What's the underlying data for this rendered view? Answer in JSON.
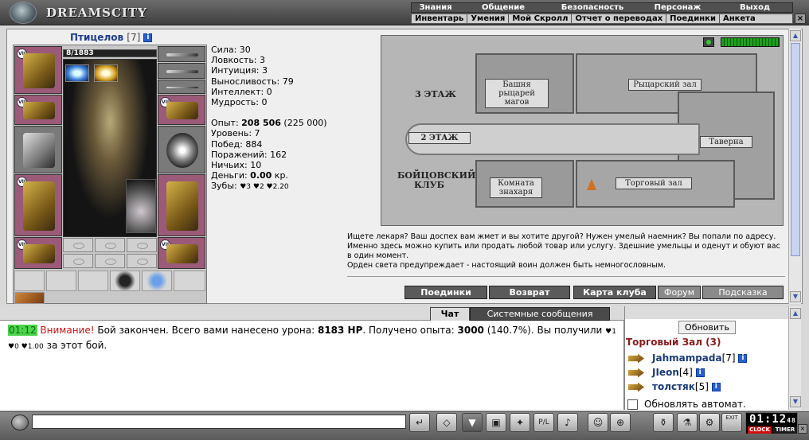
{
  "app": {
    "logo_text": "DREAMSCITY"
  },
  "menu_top": [
    "Знания",
    "Общение",
    "Безопасность",
    "Персонаж",
    "Выход"
  ],
  "menu_sub": [
    "Инвентарь",
    "Умения",
    "Мой Скролл",
    "Отчет о переводах",
    "Поединки",
    "Анкета"
  ],
  "window": {
    "close_glyph": "×",
    "minimize_glyph": "×"
  },
  "character": {
    "name": "Птицелов",
    "level": "[7]",
    "info_glyph": "i",
    "hp": "8/1883",
    "slot_badge": "VII"
  },
  "stats": {
    "strength": "Сила: 30",
    "agility": "Ловкость: 3",
    "intuition": "Интуиция: 3",
    "endurance": "Выносливость: 79",
    "intellect": "Интеллект: 0",
    "wisdom": "Мудрость: 0",
    "exp_label": "Опыт: ",
    "exp_value": "208 506",
    "exp_next": " (225 000)",
    "level": "Уровень: 7",
    "wins": "Побед: 884",
    "losses": "Поражений: 162",
    "draws": "Ничьих: 10",
    "money_label": "Деньги: ",
    "money_value": "0.00",
    "money_unit": " кр.",
    "teeth_label": "Зубы: ",
    "teeth_values": "♥3 ♥2 ♥2.20"
  },
  "map": {
    "floor3": "3 ЭТАЖ",
    "floor2": "2 ЭТАЖ",
    "club": "БОЙЦОВСКИЙ КЛУБ",
    "rooms": {
      "knights_tower": "Башня рыцарей магов",
      "knights_hall": "Рыцарский зал",
      "tavern": "Таверна",
      "healer": "Комната знахаря",
      "trade_hall": "Торговый зал"
    }
  },
  "description": {
    "text": "Ищете лекаря? Ваш доспех вам жмет и вы хотите другой? Нужен умелый наемник? Вы попали по адресу. Именно здесь можно купить или продать любой товар или услугу. Здешние умельцы и оденут и обуют вас в один момент.",
    "motto": "Орден света предупреждает - настоящий воин должен быть немногословным."
  },
  "buttons": {
    "duels": "Поединки",
    "back": "Возврат",
    "club_map": "Карта клуба",
    "forum": "Форум",
    "hint": "Подсказка"
  },
  "chat": {
    "tabs": {
      "chat": "Чат",
      "system": "Системные сообщения"
    },
    "message": {
      "time": "01:12",
      "warn": "Внимание!",
      "text1": " Бой закончен. Всего вами нанесено урона: ",
      "damage": "8183 HP",
      "text2": ". Получено опыта: ",
      "exp": "3000",
      "text3": " (140.7%). Вы получили ",
      "teeth": "♥1 ♥0 ♥1.00",
      "text4": " за этот бой."
    },
    "input_value": ""
  },
  "room_panel": {
    "refresh": "Обновить",
    "title": "Торговый Зал (3)",
    "players": [
      {
        "name": "Jahmampada",
        "level": "[7]"
      },
      {
        "name": "JIeon",
        "level": "[4]"
      },
      {
        "name": "толстяк",
        "level": "[5]"
      }
    ],
    "auto_refresh": "Обновлять автомат."
  },
  "toolbar": {
    "icons": [
      "↵",
      "◇",
      "▼",
      "▣",
      "✦",
      "P/L",
      "♪",
      "☺",
      "⊕"
    ],
    "right_icons": [
      "⚱",
      "⚗",
      "⚙",
      "⛁"
    ],
    "exit_label": "EXIT"
  },
  "clock": {
    "time": "01:12",
    "seconds": "48",
    "clock_label": "CLOCK",
    "timer_label": "TIMER"
  },
  "scrollbar": {
    "up": "▲",
    "down": "▼"
  }
}
